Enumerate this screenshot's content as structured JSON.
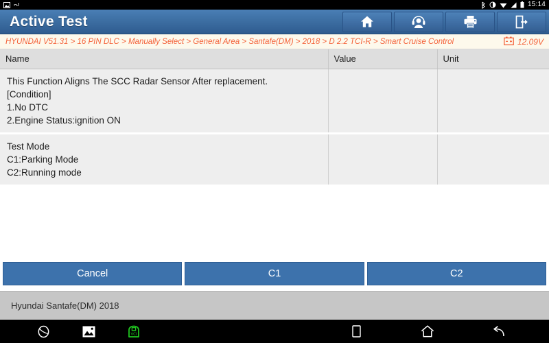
{
  "statusbar": {
    "icons": [
      "image-icon",
      "usb-debug-icon",
      "bluetooth-icon",
      "brightness-icon",
      "wifi-icon",
      "signal-icon",
      "battery-icon"
    ],
    "time": "15:14"
  },
  "titlebar": {
    "title": "Active Test",
    "buttons": [
      {
        "name": "home-button",
        "icon": "home-icon"
      },
      {
        "name": "support-button",
        "icon": "headset-person-icon"
      },
      {
        "name": "print-button",
        "icon": "printer-icon"
      },
      {
        "name": "exit-button",
        "icon": "exit-door-icon"
      }
    ]
  },
  "breadcrumb": {
    "path": "HYUNDAI V51.31 > 16 PIN DLC > Manually Select > General Area > Santafe(DM) > 2018 > D 2.2 TCI-R > Smart Cruise Control",
    "segments": [
      "HYUNDAI V51.31",
      "16 PIN DLC",
      "Manually Select",
      "General Area",
      "Santafe(DM)",
      "2018",
      "D 2.2 TCI-R",
      "Smart Cruise Control"
    ],
    "voltage": "12.09V",
    "voltage_icon": "car-battery-icon",
    "accent_color": "#f4623a",
    "background_color": "#fdf9ec"
  },
  "table": {
    "headers": {
      "name": "Name",
      "value": "Value",
      "unit": "Unit"
    },
    "rows": [
      {
        "name_lines": [
          "This Function Aligns The SCC Radar Sensor After replacement.",
          "[Condition]",
          "1.No DTC",
          "2.Engine Status:ignition ON"
        ],
        "value": "",
        "unit": ""
      },
      {
        "name_lines": [
          "Test Mode",
          "C1:Parking Mode",
          "C2:Running mode"
        ],
        "value": "",
        "unit": ""
      }
    ]
  },
  "actions": {
    "cancel_label": "Cancel",
    "c1_label": "C1",
    "c2_label": "C2",
    "button_color": "#3d72ac"
  },
  "footer": {
    "vehicle": "Hyundai Santafe(DM) 2018"
  },
  "navbar": {
    "left": [
      {
        "name": "browser-icon"
      },
      {
        "name": "gallery-image-icon"
      },
      {
        "name": "vci-connector-icon",
        "color": "#1fc41f"
      }
    ],
    "right": [
      {
        "name": "recents-square-icon"
      },
      {
        "name": "home-icon"
      },
      {
        "name": "back-arrow-icon"
      }
    ]
  }
}
